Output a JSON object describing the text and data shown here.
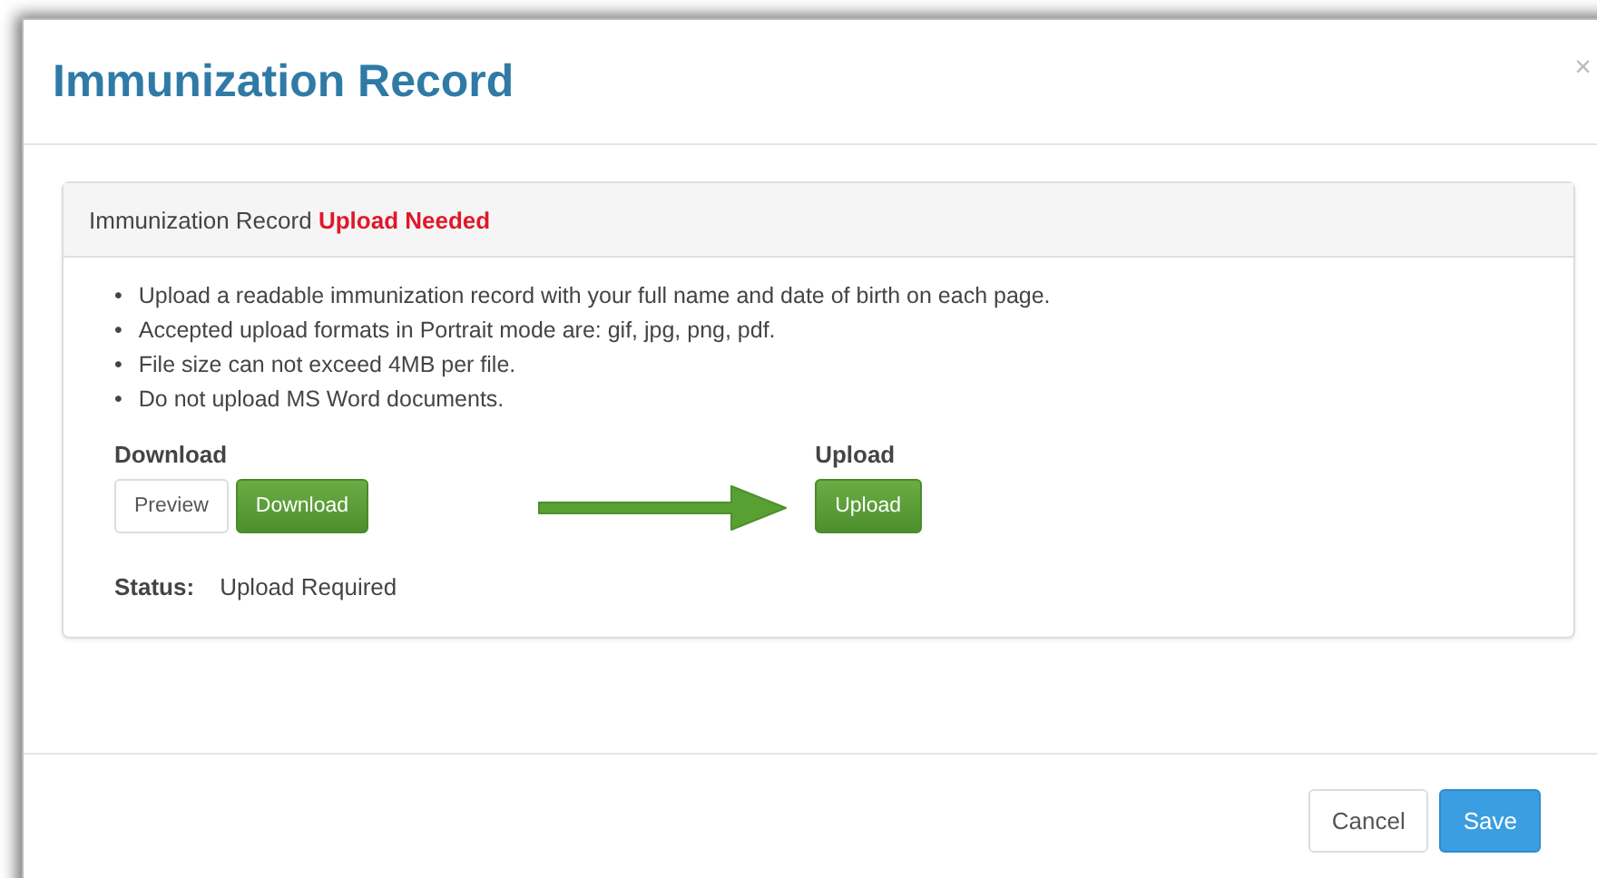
{
  "modal": {
    "title": "Immunization Record",
    "close": "×"
  },
  "panel": {
    "heading": "Immunization Record **Upload Needed**",
    "bullet": "•",
    "instructions": [
      "Upload a readable immunization record with your full name and date of birth on each page.",
      "Accepted upload formats in Portrait mode are: gif, jpg, png, pdf.",
      "File size can not exceed 4MB per file.",
      "Do not upload MS Word documents."
    ],
    "download": {
      "label": "Download",
      "buttons": [
        {
          "label": "Preview",
          "kind": "default"
        },
        {
          "label": "Download",
          "kind": "success"
        }
      ]
    },
    "upload": {
      "label": "Upload",
      "buttons": [
        {
          "label": "Upload",
          "kind": "success"
        }
      ]
    },
    "status": {
      "label": "Status:",
      "value": "Upload Required"
    }
  },
  "footer": {
    "buttons": [
      {
        "label": "Cancel",
        "kind": "default"
      },
      {
        "label": "Save",
        "kind": "primary"
      }
    ]
  }
}
